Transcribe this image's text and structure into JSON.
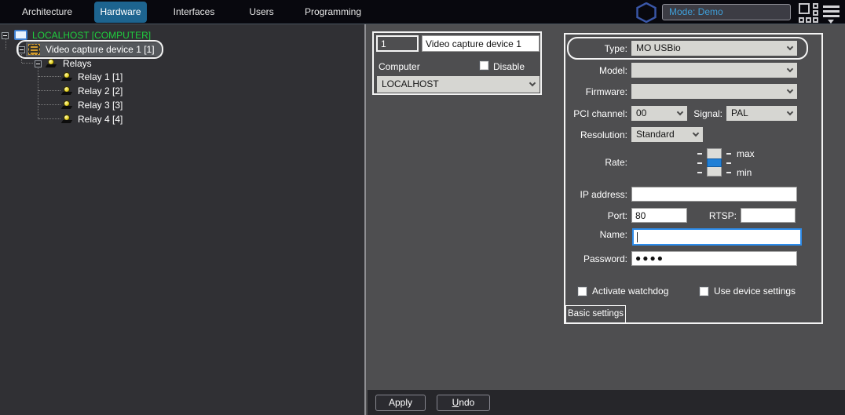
{
  "topbar": {
    "tabs": [
      {
        "label": "Architecture",
        "active": false
      },
      {
        "label": "Hardware",
        "active": true
      },
      {
        "label": "Interfaces",
        "active": false
      },
      {
        "label": "Users",
        "active": false
      },
      {
        "label": "Programming",
        "active": false
      }
    ],
    "mode_value": "Mode: Demo"
  },
  "tree": {
    "computer": "LOCALHOST [COMPUTER]",
    "device": "Video capture device 1 [1]",
    "group": "Relays",
    "relays": [
      "Relay 1 [1]",
      "Relay 2 [2]",
      "Relay 3 [3]",
      "Relay 4 [4]"
    ]
  },
  "device_box": {
    "id_value": "1",
    "name_value": "Video capture device 1",
    "computer_label": "Computer",
    "disable_label": "Disable",
    "computer_value": "LOCALHOST"
  },
  "settings": {
    "type_label": "Type:",
    "type_value": "MO USBio",
    "model_label": "Model:",
    "model_value": "",
    "firmware_label": "Firmware:",
    "firmware_value": "",
    "pci_label": "PCI channel:",
    "pci_value": "00",
    "signal_label": "Signal:",
    "signal_value": "PAL",
    "resolution_label": "Resolution:",
    "resolution_value": "Standard",
    "rate_label": "Rate:",
    "rate_max_label": "max",
    "rate_min_label": "min",
    "ip_label": "IP address:",
    "ip_value": "",
    "port_label": "Port:",
    "port_value": "80",
    "rtsp_label": "RTSP:",
    "rtsp_value": "",
    "name_label": "Name:",
    "name_value": "",
    "password_label": "Password:",
    "password_value": "●●●●",
    "watchdog_label": "Activate watchdog",
    "use_device_settings_label": "Use device settings",
    "bottom_tab_label": "Basic settings"
  },
  "actions": {
    "apply_label": "Apply",
    "undo_label": "Undo"
  },
  "colors": {
    "active_tab_blue": "#1d648f",
    "computer_green": "#1fce3e",
    "focus_blue": "#2d8ceb",
    "slider_blue": "#1f7fd6",
    "mode_text_blue": "#3f9fd9",
    "highlight_outline": "#f4f4f4"
  }
}
